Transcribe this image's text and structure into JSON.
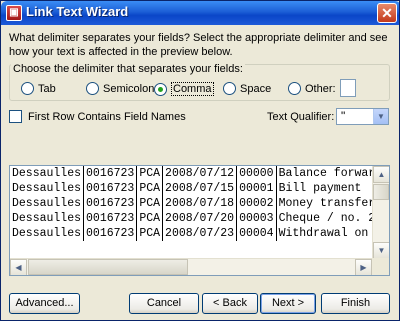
{
  "window": {
    "title": "Link Text Wizard",
    "close": "✕",
    "icon_glyph": "▣"
  },
  "instructions": "What delimiter separates your fields? Select the appropriate delimiter and see how your text is affected in the preview below.",
  "delimiter": {
    "legend": "Choose the delimiter that separates your fields:",
    "options": [
      {
        "label": "Tab",
        "selected": false
      },
      {
        "label": "Semicolon",
        "selected": false
      },
      {
        "label": "Comma",
        "selected": true
      },
      {
        "label": "Space",
        "selected": false
      },
      {
        "label": "Other:",
        "selected": false
      }
    ],
    "other_value": ""
  },
  "first_row": {
    "label": "First Row Contains Field Names",
    "checked": false
  },
  "text_qualifier": {
    "label": "Text Qualifier:",
    "value": "\""
  },
  "preview": {
    "rows": [
      [
        "Dessaulles",
        "0016723",
        "PCA",
        "2008/07/12",
        "00000",
        "Balance forwar"
      ],
      [
        "Dessaulles",
        "0016723",
        "PCA",
        "2008/07/15",
        "00001",
        "Bill payment"
      ],
      [
        "Dessaulles",
        "0016723",
        "PCA",
        "2008/07/18",
        "00002",
        "Money transfer"
      ],
      [
        "Dessaulles",
        "0016723",
        "PCA",
        "2008/07/20",
        "00003",
        "Cheque / no. 2"
      ],
      [
        "Dessaulles",
        "0016723",
        "PCA",
        "2008/07/23",
        "00004",
        "Withdrawal on"
      ]
    ]
  },
  "buttons": {
    "advanced": "Advanced...",
    "cancel": "Cancel",
    "back": "< Back",
    "next": "Next >",
    "finish": "Finish"
  },
  "colors": {
    "title_bar": "#0a46c8",
    "dialog_bg": "#ece9d8",
    "accent_radio": "#21a121"
  }
}
